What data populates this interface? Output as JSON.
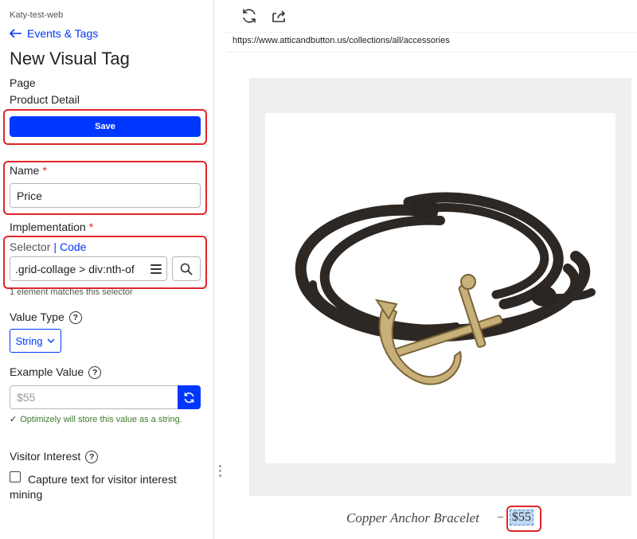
{
  "sidebar": {
    "project": "Katy-test-web",
    "back_link": "Events & Tags",
    "title": "New Visual Tag",
    "page_label": "Page",
    "page_value": "Product Detail",
    "save_label": "Save",
    "name_label": "Name",
    "required_mark": "*",
    "name_value": "Price",
    "implementation_label": "Implementation",
    "tab_selector": "Selector",
    "tab_separator": "|",
    "tab_code": "Code",
    "selector_value": ".grid-collage > div:nth-of",
    "match_text": "1 element matches this selector",
    "value_type_label": "Value Type",
    "value_type_selected": "String",
    "example_value_label": "Example Value",
    "example_value_placeholder": "$55",
    "store_note": "Optimizely will store this value as a string.",
    "visitor_interest_label": "Visitor Interest",
    "capture_label_line1": "Capture text for visitor interest",
    "capture_label_line2": "mining",
    "help_glyph": "?"
  },
  "preview": {
    "url": "https://www.atticandbutton.us/collections/all/accessories",
    "product_name": "Copper Anchor Bracelet",
    "product_price": "$55"
  },
  "icons": {
    "back": "arrow-left-icon",
    "refresh": "refresh-icon",
    "open_external": "open-external-icon",
    "menu": "hamburger-icon",
    "search": "search-icon",
    "chevron": "chevron-down-icon",
    "check": "checkmark-icon",
    "help": "help-circle-icon"
  },
  "colors": {
    "accent": "#0037ff",
    "highlight_border": "#e0252b",
    "success_text": "#3d7a2d"
  }
}
